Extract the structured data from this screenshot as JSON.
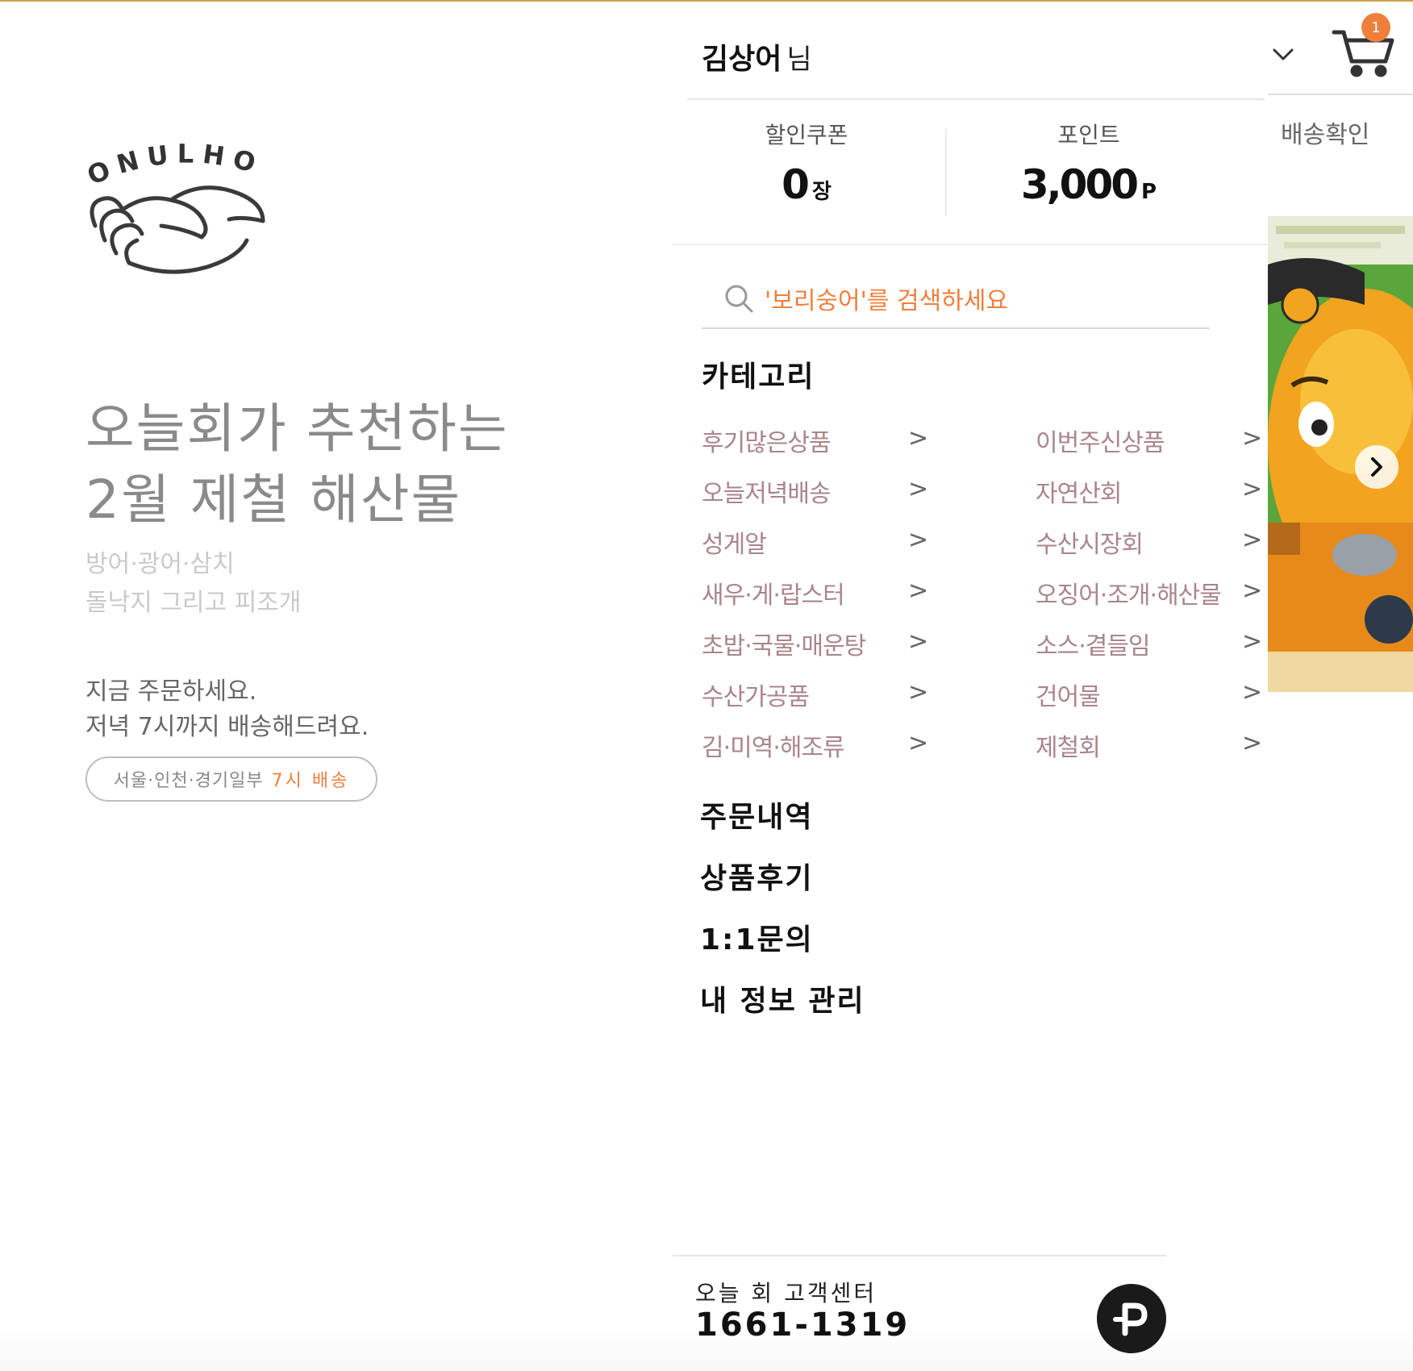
{
  "logo": {
    "text": "ONULHOI"
  },
  "promo": {
    "headline": "오늘회가 추천하는\n2월 제철 해산물",
    "subline": "방어·광어·삼치\n돌낙지 그리고 피조개",
    "order_text": "지금 주문하세요.\n저녁 7시까지 배송해드려요.",
    "delivery_area": "서울·인천·경기일부",
    "delivery_time": "7시 배송"
  },
  "user": {
    "name": "김상어",
    "suffix": "님"
  },
  "cart": {
    "count": "1"
  },
  "stats": {
    "coupon_label": "할인쿠폰",
    "coupon_value": "0",
    "coupon_unit": "장",
    "point_label": "포인트",
    "point_value": "3,000",
    "point_unit": "P"
  },
  "shipping_check": "배송확인",
  "search": {
    "placeholder": "'보리숭어'를 검색하세요"
  },
  "category": {
    "title": "카테고리",
    "arrow": ">",
    "left": [
      "후기많은상품",
      "오늘저녁배송",
      "성게알",
      "새우·게·랍스터",
      "초밥·국물·매운탕",
      "수산가공품",
      "김·미역·해조류"
    ],
    "right": [
      "이번주신상품",
      "자연산회",
      "수산시장회",
      "오징어·조개·해산물",
      "소스·곁들임",
      "건어물",
      "제철회"
    ]
  },
  "menu": {
    "orders": "주문내역",
    "reviews": "상품후기",
    "inquiry": "1:1문의",
    "my_info": "내 정보 관리"
  },
  "customer_center": {
    "label": "오늘 회 고객센터",
    "phone": "1661-1319"
  },
  "colors": {
    "accent": "#f07f3c",
    "top_line": "#c5a64a",
    "category_text": "#a9858a"
  },
  "icons": [
    "search-icon",
    "chevron-down-icon",
    "cart-icon",
    "chevron-right-icon",
    "p-icon"
  ]
}
